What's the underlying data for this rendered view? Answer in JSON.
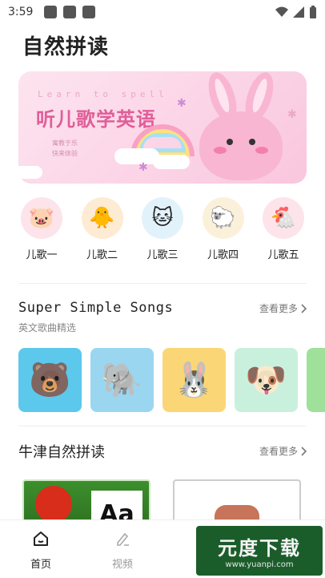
{
  "status": {
    "time": "3:59"
  },
  "page": {
    "title": "自然拼读"
  },
  "banner": {
    "learn_text": "Learn to spell",
    "title": "听儿歌学英语",
    "sub1": "寓教于乐",
    "sub2": "快来体验"
  },
  "songs": [
    {
      "label": "儿歌一",
      "icon": "pig-icon",
      "bg": "#fde3ea"
    },
    {
      "label": "儿歌二",
      "icon": "chick-icon",
      "bg": "#fdebd3"
    },
    {
      "label": "儿歌三",
      "icon": "cat-icon",
      "bg": "#e2f2fb"
    },
    {
      "label": "儿歌四",
      "icon": "sheep-icon",
      "bg": "#fbf1da"
    },
    {
      "label": "儿歌五",
      "icon": "rooster-icon",
      "bg": "#fde3ea"
    }
  ],
  "section1": {
    "title": "Super Simple Songs",
    "subtitle": "英文歌曲精选",
    "more": "查看更多"
  },
  "cards": [
    {
      "name": "bear-card",
      "bg": "#5cc8ec"
    },
    {
      "name": "elephant-card",
      "bg": "#9ad6f0"
    },
    {
      "name": "bunny-card",
      "bg": "#fbd676"
    },
    {
      "name": "dog-card",
      "bg": "#c9f0dd"
    },
    {
      "name": "partial-card",
      "bg": "#9fe09a"
    }
  ],
  "section2": {
    "title": "牛津自然拼读",
    "more": "查看更多"
  },
  "book_a": {
    "letters": "Aa"
  },
  "tabs": [
    {
      "label": "首页",
      "icon": "home-icon",
      "active": true
    },
    {
      "label": "视频",
      "icon": "pen-icon",
      "active": false
    }
  ],
  "watermark": {
    "big": "元度下载",
    "small": "www.yuanpi.com"
  }
}
